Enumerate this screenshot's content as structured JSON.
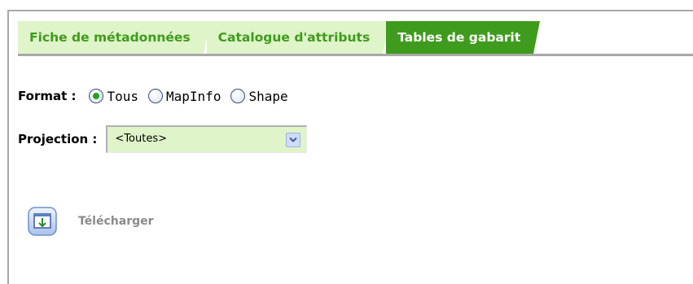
{
  "tabs": [
    {
      "label": "Fiche de métadonnées",
      "active": false
    },
    {
      "label": "Catalogue d'attributs",
      "active": false
    },
    {
      "label": "Tables de gabarit",
      "active": true
    }
  ],
  "format": {
    "label": "Format :",
    "options": [
      "Tous",
      "MapInfo",
      "Shape"
    ],
    "selected": "Tous"
  },
  "projection": {
    "label": "Projection :",
    "value": "<Toutes>"
  },
  "download": {
    "label": "Télécharger",
    "icon": "download-icon"
  },
  "colors": {
    "accent": "#3f9b1d",
    "tab_inactive_bg": "#dff4c8",
    "radio_dot": "#21a121",
    "muted_text": "#8a8a8a"
  }
}
